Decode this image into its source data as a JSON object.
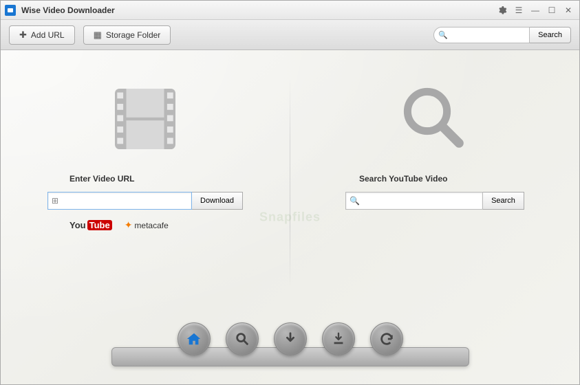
{
  "titlebar": {
    "title": "Wise Video Downloader"
  },
  "toolbar": {
    "add_url_label": "Add URL",
    "storage_folder_label": "Storage Folder",
    "search_placeholder": "",
    "search_btn": "Search"
  },
  "left_panel": {
    "label": "Enter Video URL",
    "action": "Download",
    "brand1": "You",
    "brand1b": "Tube",
    "brand2": "metacafe"
  },
  "right_panel": {
    "label": "Search YouTube Video",
    "action": "Search"
  },
  "dock": {
    "icons": [
      "home",
      "search",
      "download",
      "download-to",
      "refresh"
    ]
  },
  "watermark": "Snapfiles"
}
